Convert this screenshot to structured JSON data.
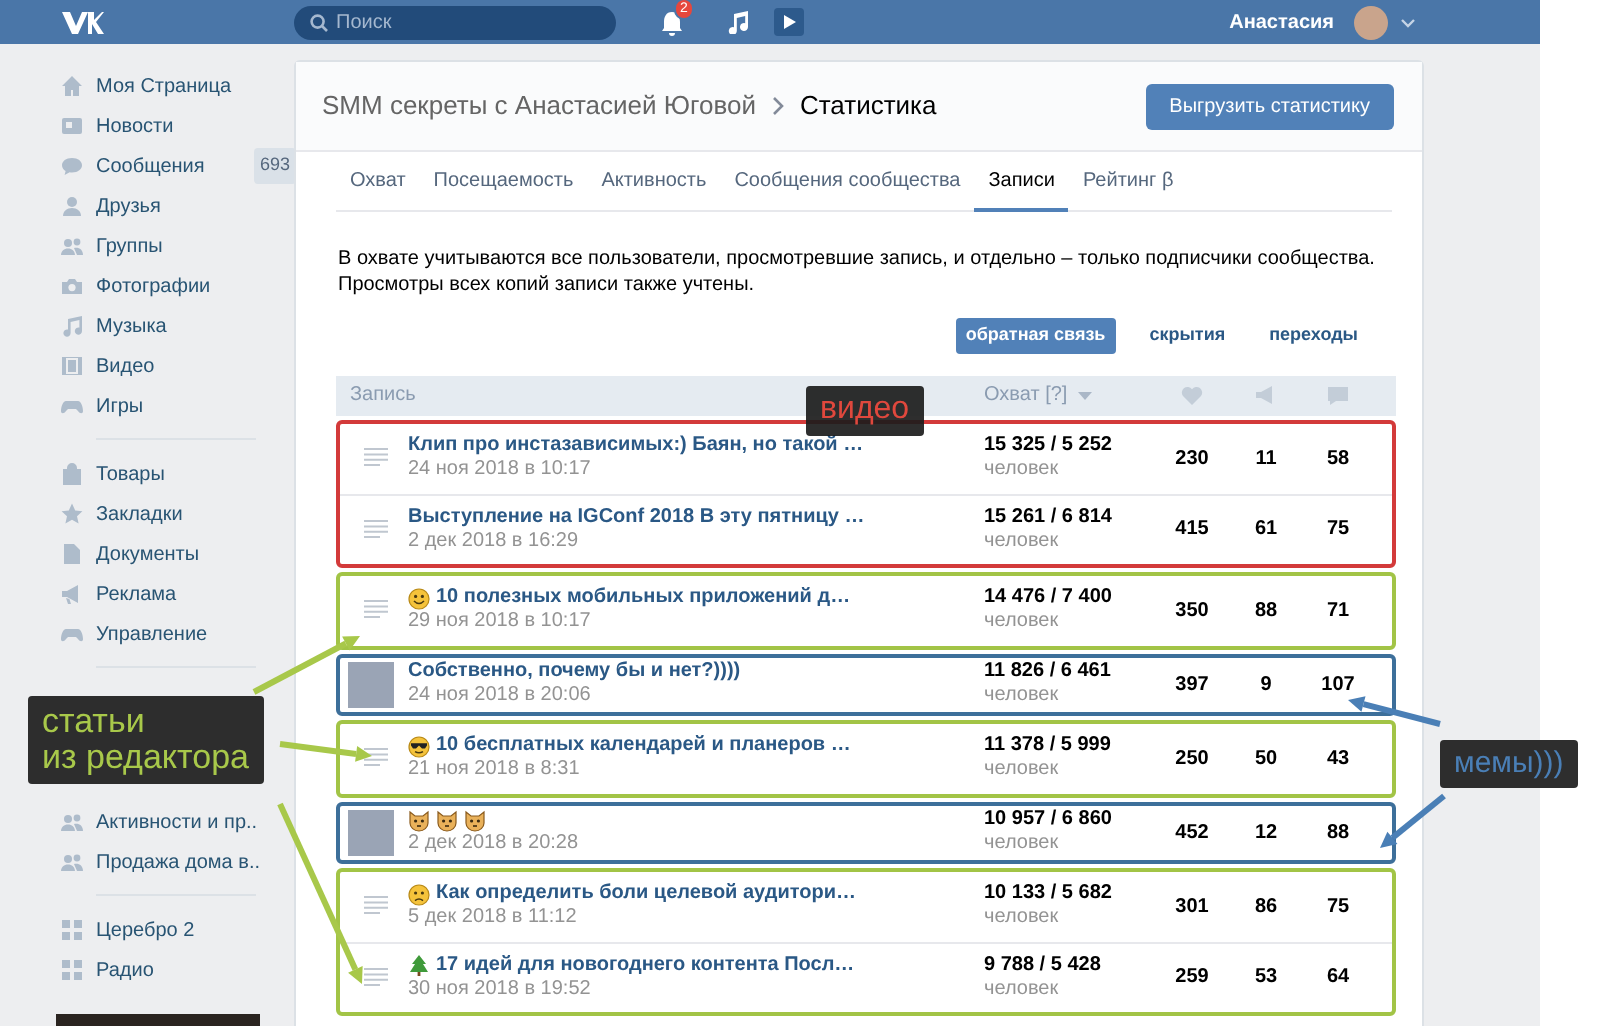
{
  "topbar": {
    "search": {
      "placeholder": "Поиск"
    },
    "notifications_badge": "2",
    "user_name": "Анастасия"
  },
  "sidebar": {
    "sections": [
      {
        "items": [
          {
            "label": "Моя Страница"
          },
          {
            "label": "Новости"
          },
          {
            "label": "Сообщения",
            "counter": "693"
          },
          {
            "label": "Друзья"
          },
          {
            "label": "Группы"
          },
          {
            "label": "Фотографии"
          },
          {
            "label": "Музыка"
          },
          {
            "label": "Видео"
          },
          {
            "label": "Игры"
          }
        ]
      },
      {
        "items": [
          {
            "label": "Товары"
          },
          {
            "label": "Закладки"
          },
          {
            "label": "Документы"
          },
          {
            "label": "Реклама"
          },
          {
            "label": "Управление"
          }
        ]
      },
      {
        "items": [
          {
            "label": "Активности и пр.."
          },
          {
            "label": "Продажа дома в.."
          }
        ]
      },
      {
        "items": [
          {
            "label": "Церебро 2"
          },
          {
            "label": "Радио"
          }
        ]
      }
    ]
  },
  "header": {
    "community": "SMM секреты с Анастасией Юговой",
    "page": "Статистика",
    "export_button": "Выгрузить статистику"
  },
  "tabs": [
    {
      "label": "Охват",
      "selected": false
    },
    {
      "label": "Посещаемость",
      "selected": false
    },
    {
      "label": "Активность",
      "selected": false
    },
    {
      "label": "Сообщения сообщества",
      "selected": false
    },
    {
      "label": "Записи",
      "selected": true
    },
    {
      "label": "Рейтинг β",
      "selected": false
    }
  ],
  "description": [
    "В охвате учитываются все пользователи, просмотревшие запись, и отдельно – только подписчики сообщества.",
    "Просмотры всех копий записи также учтены."
  ],
  "filters": [
    {
      "label": "обратная связь",
      "selected": true
    },
    {
      "label": "скрытия",
      "selected": false
    },
    {
      "label": "переходы",
      "selected": false
    }
  ],
  "table": {
    "columns": [
      "Запись",
      "Охват [?]"
    ],
    "groups": [
      {
        "color": "#d33a3a",
        "rows": [
          {
            "kind": "text",
            "title": "Клип про инстазависимых:) Баян, но такой …",
            "date": "24 ноя 2018 в 10:17",
            "reach": "15 325 / 5 252",
            "unit": "человек",
            "likes": "230",
            "reposts": "11",
            "comments": "58"
          },
          {
            "kind": "text",
            "title": "Выступление на IGConf 2018 В эту пятницу …",
            "date": "2 дек 2018 в 16:29",
            "reach": "15 261 / 6 814",
            "unit": "человек",
            "likes": "415",
            "reposts": "61",
            "comments": "75"
          }
        ]
      },
      {
        "color": "#a2c446",
        "rows": [
          {
            "kind": "text",
            "title": "10 полезных мобильных приложений д…",
            "date": "29 ноя 2018 в 10:17",
            "reach": "14 476 / 7 400",
            "unit": "человек",
            "likes": "350",
            "reposts": "88",
            "comments": "71"
          }
        ]
      },
      {
        "color": "#3d6f9a",
        "rows": [
          {
            "kind": "image",
            "title": "Собственно, почему бы и нет?))))",
            "date": "24 ноя 2018 в 20:06",
            "reach": "11 826 / 6 461",
            "unit": "человек",
            "likes": "397",
            "reposts": "9",
            "comments": "107"
          }
        ]
      },
      {
        "color": "#a2c446",
        "rows": [
          {
            "kind": "text",
            "title": "10 бесплатных календарей и планеров …",
            "date": "21 ноя 2018 в 8:31",
            "reach": "11 378 / 5 999",
            "unit": "человек",
            "likes": "250",
            "reposts": "50",
            "comments": "43"
          }
        ]
      },
      {
        "color": "#3d6f9a",
        "rows": [
          {
            "kind": "image",
            "date": "2 дек 2018 в 20:28",
            "reach": "10 957 / 6 860",
            "unit": "человек",
            "likes": "452",
            "reposts": "12",
            "comments": "88"
          }
        ]
      },
      {
        "color": "#a2c446",
        "rows": [
          {
            "kind": "text",
            "title": "Как определить боли целевой аудитори…",
            "date": "5 дек 2018 в 11:12",
            "reach": "10 133 / 5 682",
            "unit": "человек",
            "likes": "301",
            "reposts": "86",
            "comments": "75"
          },
          {
            "kind": "text",
            "title": "17 идей для новогоднего контента Посл…",
            "date": "30 ноя 2018 в 19:52",
            "reach": "9 788 / 5 428",
            "unit": "человек",
            "likes": "259",
            "reposts": "53",
            "comments": "64"
          }
        ]
      }
    ]
  },
  "callouts": [
    {
      "kind": "video",
      "lines": [
        "видео"
      ]
    },
    {
      "kind": "articles",
      "lines": [
        "статьи",
        "из редактора"
      ]
    },
    {
      "kind": "memes",
      "lines": [
        "мемы)))"
      ]
    }
  ]
}
